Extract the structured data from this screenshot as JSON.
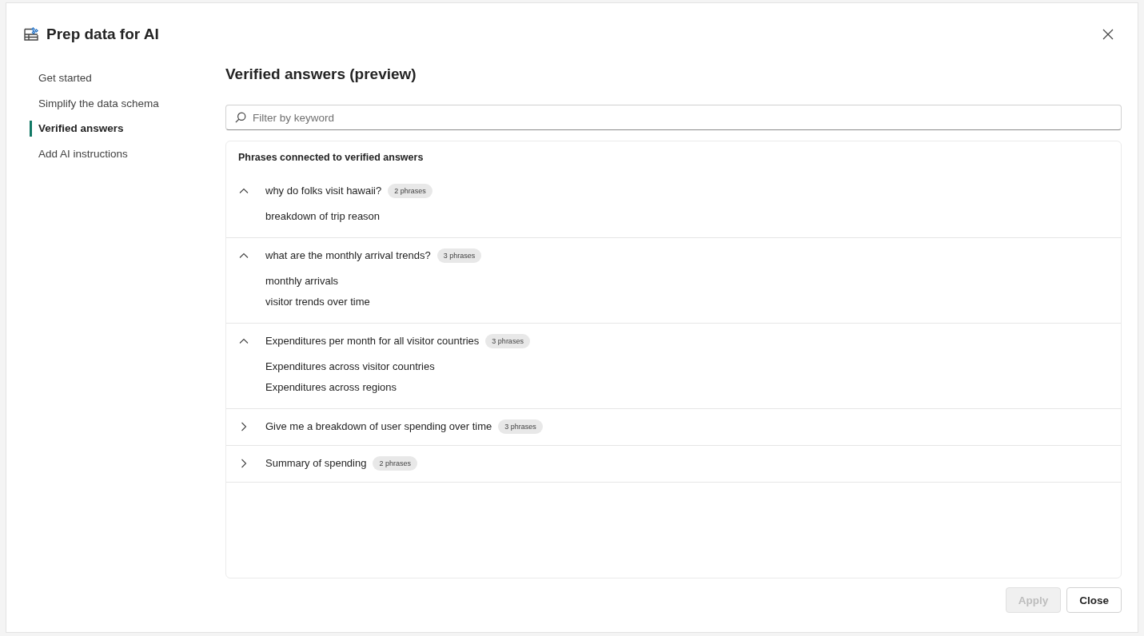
{
  "dialog": {
    "title": "Prep data for AI"
  },
  "sidebar": {
    "items": [
      {
        "label": "Get started",
        "selected": false
      },
      {
        "label": "Simplify the data schema",
        "selected": false
      },
      {
        "label": "Verified answers",
        "selected": true
      },
      {
        "label": "Add AI instructions",
        "selected": false
      }
    ]
  },
  "content": {
    "heading": "Verified answers (preview)",
    "search": {
      "placeholder": "Filter by keyword"
    },
    "panel": {
      "title": "Phrases connected to verified answers",
      "groups": [
        {
          "question": "why do folks visit hawaii?",
          "badge": "2 phrases",
          "expanded": true,
          "phrases": [
            "breakdown of trip reason"
          ]
        },
        {
          "question": "what are the monthly arrival trends?",
          "badge": "3 phrases",
          "expanded": true,
          "phrases": [
            "monthly arrivals",
            "visitor trends over time"
          ]
        },
        {
          "question": "Expenditures per month for all visitor countries",
          "badge": "3 phrases",
          "expanded": true,
          "phrases": [
            "Expenditures across visitor countries",
            "Expenditures across regions"
          ]
        },
        {
          "question": "Give me a breakdown of user spending over time",
          "badge": "3 phrases",
          "expanded": false
        },
        {
          "question": "Summary of spending",
          "badge": "2 phrases",
          "expanded": false
        }
      ]
    }
  },
  "buttons": [
    {
      "label": "Apply",
      "disabled": true
    },
    {
      "label": "Close",
      "disabled": false
    }
  ]
}
